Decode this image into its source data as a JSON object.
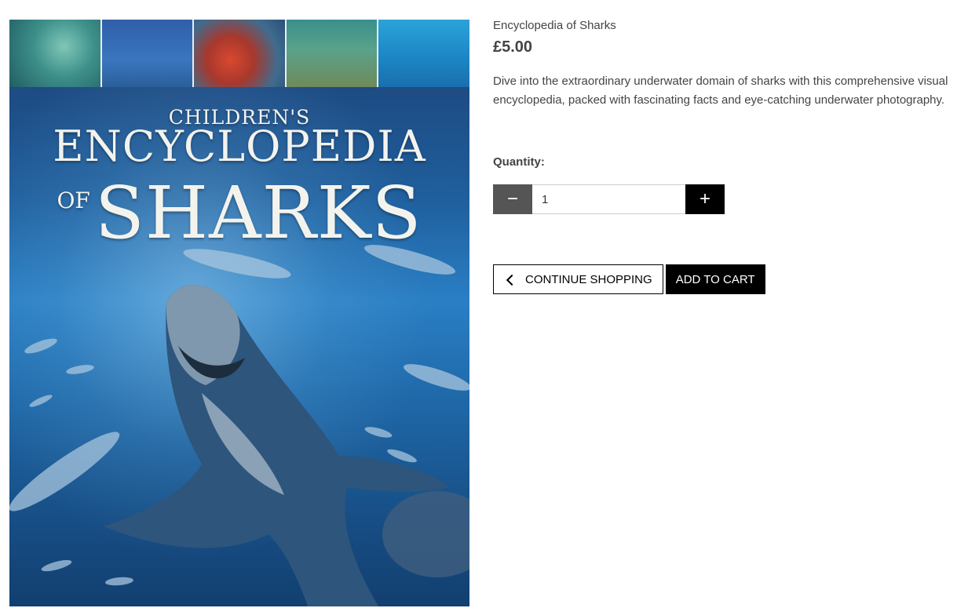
{
  "product": {
    "name": "Encyclopedia of Sharks",
    "price": "£5.00",
    "description": "Dive into the extraordinary underwater domain of sharks with this comprehensive visual encyclopedia, packed with fascinating facts and eye-catching underwater photography.",
    "cover": {
      "line1": "CHILDREN'S",
      "line2": "ENCYCLOPEDIA",
      "of": "OF",
      "line3": "SHARKS"
    }
  },
  "quantity": {
    "label": "Quantity:",
    "value": "1",
    "minus_symbol": "−",
    "plus_symbol": "+"
  },
  "actions": {
    "continue_label": "CONTINUE SHOPPING",
    "add_label": "ADD TO CART"
  },
  "colors": {
    "primary_button": "#000000",
    "minus_button": "#555555",
    "text": "#444444"
  }
}
